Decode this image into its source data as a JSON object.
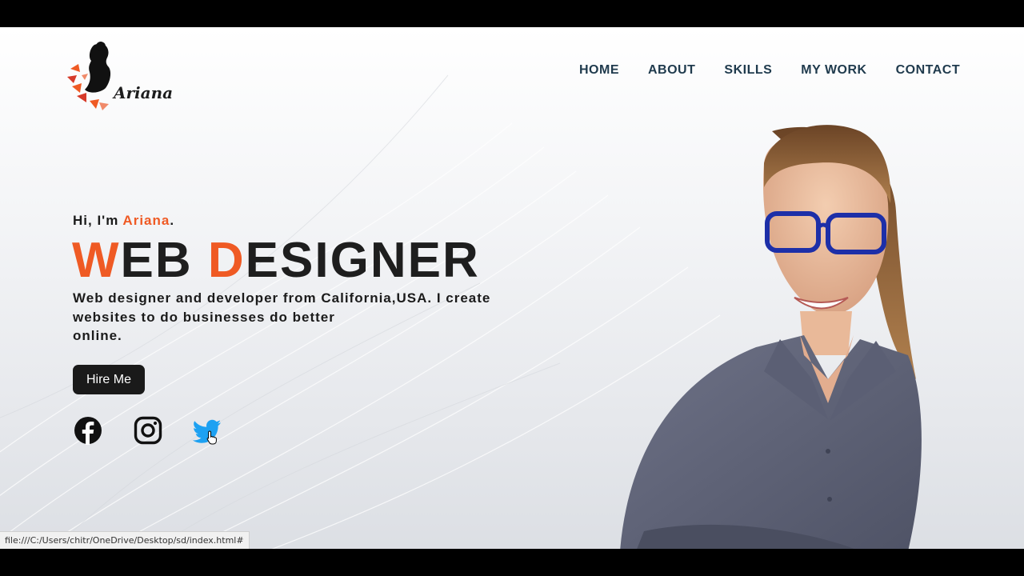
{
  "brand": {
    "name": "Ariana"
  },
  "nav": {
    "items": [
      {
        "label": "HOME"
      },
      {
        "label": "ABOUT"
      },
      {
        "label": "SKILLS"
      },
      {
        "label": "MY WORK"
      },
      {
        "label": "CONTACT"
      }
    ]
  },
  "hero": {
    "greeting_prefix": "Hi, I'm ",
    "greeting_name": "Ariana",
    "greeting_suffix": ".",
    "headline": {
      "word1_first": "W",
      "word1_rest": "EB ",
      "word2_first": "D",
      "word2_rest": "ESIGNER"
    },
    "description_lines": [
      "Web designer and developer from California,USA. I create",
      "websites to do businesses do better",
      "online."
    ],
    "cta_label": "Hire Me"
  },
  "socials": [
    {
      "icon": "facebook-icon",
      "color": "#111111"
    },
    {
      "icon": "instagram-icon",
      "color": "#111111"
    },
    {
      "icon": "twitter-icon",
      "color": "#1da1f2"
    }
  ],
  "status_bar": {
    "url": "file:///C:/Users/chitr/OneDrive/Desktop/sd/index.html#"
  },
  "colors": {
    "accent": "#ef5a24",
    "nav_text": "#1f3a4d",
    "button_bg": "#1a1a1a"
  }
}
